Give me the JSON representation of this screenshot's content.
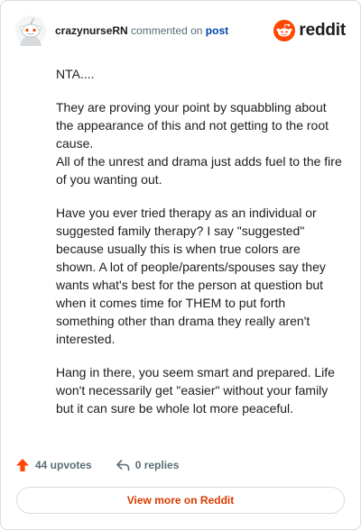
{
  "header": {
    "username": "crazynurseRN",
    "action_text": "commented on",
    "post_link": "post",
    "brand_name": "reddit",
    "avatar_icon": "reddit-snoo-avatar-icon",
    "brand_icon": "reddit-alien-logo-icon"
  },
  "comment": {
    "paragraphs": [
      "NTA....",
      "They are proving your point by squabbling about the appearance of this and not getting to the root cause.",
      "All of the unrest and drama just adds fuel to the fire of you wanting out.",
      "Have you ever tried therapy as an individual or suggested family therapy? I say \"suggested\" because usually this is when true colors are shown. A lot of people/parents/spouses say they wants what's best for the person at question but when it comes time for THEM to put forth something other than drama they really aren't interested.",
      "Hang in there, you seem smart and prepared. Life won't necessarily get \"easier\" without your family but it can sure be whole lot more peaceful."
    ]
  },
  "footer": {
    "upvotes": "44 upvotes",
    "replies": "0 replies",
    "upvote_icon": "upvote-arrow-icon",
    "reply_icon": "reply-arrow-icon"
  },
  "view_more": {
    "label": "View more on Reddit"
  },
  "colors": {
    "brand_orange": "#ff4500",
    "link_blue": "#0045ac",
    "view_more_text": "#d93a00",
    "meta_gray": "#576f76",
    "border": "#dcdcdc"
  }
}
